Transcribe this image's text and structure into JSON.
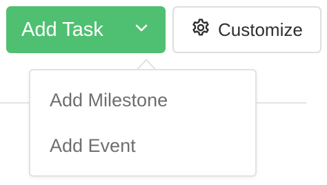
{
  "toolbar": {
    "add_task_label": "Add Task",
    "dropdown_icon": "chevron-down-icon",
    "customize_label": "Customize",
    "customize_icon": "gear-icon"
  },
  "dropdown": {
    "items": [
      {
        "label": "Add Milestone"
      },
      {
        "label": "Add Event"
      }
    ]
  },
  "colors": {
    "primary_green": "#4fc071",
    "button_text": "#ffffff",
    "menu_text": "#6e6e6e",
    "border": "#dedede"
  }
}
